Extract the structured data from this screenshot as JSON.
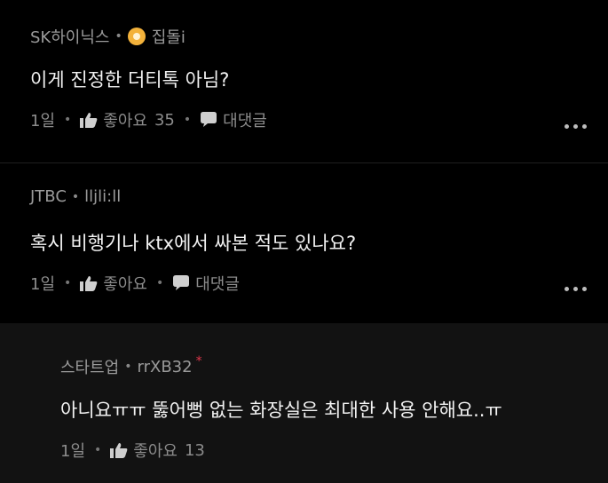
{
  "comments": [
    {
      "author": "SK하이닉스",
      "nickname": "집돌i",
      "badge_icon": "flower-badge-icon",
      "text": "이게 진정한 더티톡 아님?",
      "time": "1일",
      "like_label": "좋아요",
      "like_count": "35",
      "reply_label": "대댓글"
    },
    {
      "author": "JTBC",
      "nickname": "lljli:ll",
      "text": "혹시 비행기나 ktx에서 싸본 적도 있나요?",
      "time": "1일",
      "like_label": "좋아요",
      "reply_label": "대댓글"
    }
  ],
  "reply": {
    "author": "스타트업",
    "nickname": "rrXB32",
    "author_marker": "*",
    "text": "아니요ㅠㅠ 뚫어뻥 없는 화장실은 최대한 사용 안해요..ㅠ",
    "time": "1일",
    "like_label": "좋아요",
    "like_count": "13"
  },
  "colors": {
    "background": "#000000",
    "reply_background": "#121212",
    "text": "#f2f2f2",
    "meta": "#9a9a9a",
    "badge": "#f3b23b",
    "author_marker": "#e2374b"
  },
  "icons": [
    "thumbs-up-icon",
    "speech-bubble-icon",
    "more-options-icon",
    "flower-badge-icon"
  ]
}
